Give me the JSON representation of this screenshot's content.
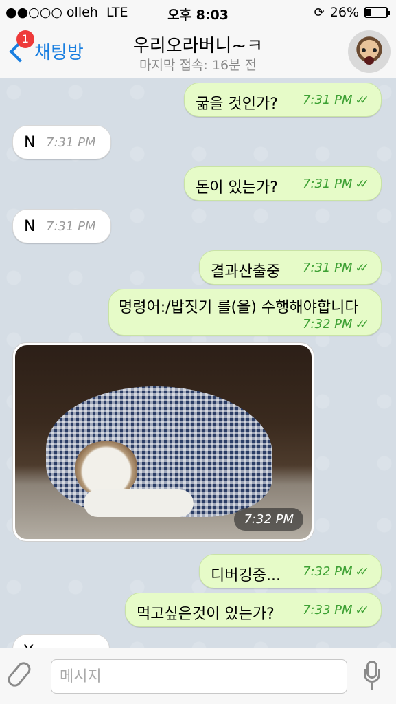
{
  "status": {
    "carrier": "●●○○○ olleh",
    "network": "LTE",
    "time": "오후 8:03",
    "battery": "26%",
    "battery_level": 0.26
  },
  "nav": {
    "back_label": "채팅방",
    "badge": "1",
    "title": "우리오라버니~ㅋ",
    "subtitle": "마지막 접속: 16분 전"
  },
  "messages": [
    {
      "dir": "out",
      "text": "굶을 것인가?",
      "time": "7:31 PM"
    },
    {
      "dir": "in",
      "text": "N",
      "time": "7:31 PM"
    },
    {
      "dir": "out",
      "text": "돈이 있는가?",
      "time": "7:31 PM"
    },
    {
      "dir": "in",
      "text": "N",
      "time": "7:31 PM"
    },
    {
      "dir": "out",
      "text": "결과산출중",
      "time": "7:31 PM"
    },
    {
      "dir": "out",
      "text": "명령어:/밥짓기 를(을) 수행해야합니다",
      "time": "7:32 PM"
    },
    {
      "dir": "out",
      "text": "디버깅중...",
      "time": "7:32 PM"
    },
    {
      "dir": "out",
      "text": "먹고싶은것이 있는가?",
      "time": "7:33 PM"
    },
    {
      "dir": "in",
      "text": "Y",
      "time": ""
    }
  ],
  "photo": {
    "time": "7:32 PM"
  },
  "input": {
    "placeholder": "메시지"
  },
  "check_glyph": "✓✓"
}
